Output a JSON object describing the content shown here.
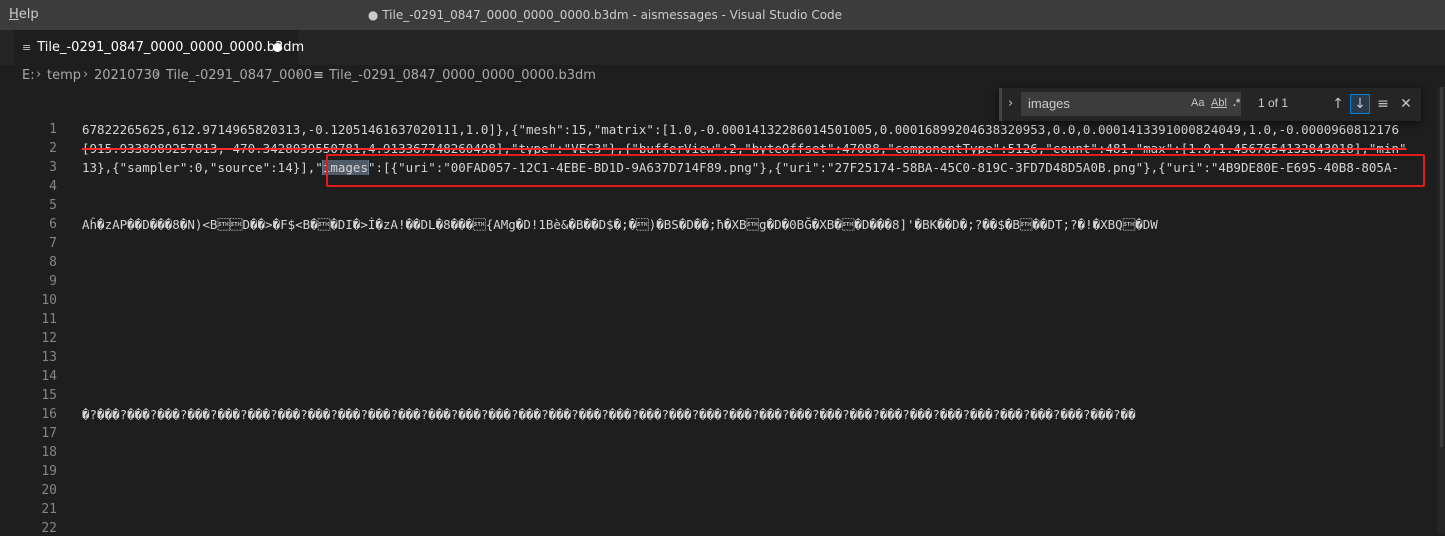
{
  "titlebar": {
    "menu_help_first": "H",
    "menu_help_rest": "elp",
    "window_title": "● Tile_-0291_0847_0000_0000_0000.b3dm - aismessages - Visual Studio Code"
  },
  "tab": {
    "label": "Tile_-0291_0847_0000_0000_0000.b3dm",
    "icon": "file-lines-icon"
  },
  "breadcrumb": {
    "items": [
      "E:",
      "temp",
      "20210730",
      "Tile_-0291_0847_0000",
      "Tile_-0291_0847_0000_0000_0000.b3dm"
    ]
  },
  "find": {
    "query": "images",
    "opt_case": "Aa",
    "opt_word": "Abl",
    "opt_regex": ".*",
    "count": "1 of 1",
    "colors": {
      "active_border": "#007fd4"
    }
  },
  "editor": {
    "line_numbers": [
      "1",
      "2",
      "3",
      "4",
      "5",
      "6",
      "7",
      "8",
      "9",
      "10",
      "11",
      "12",
      "13",
      "14",
      "15",
      "16",
      "17",
      "18",
      "19",
      "20",
      "21",
      "22"
    ],
    "line1": "67822265625,612.9714965820313,-0.12051461637020111,1.0]},{\"mesh\":15,\"matrix\":[1.0,-0.00014132286014501005,0.00016899204638320953,0.0,0.0001413391000824049,1.0,-0.0000960812176",
    "line2": "[915.9338989257813,-470.3428039550781,4.913367748260498],\"type\":\"VEC3\"},{\"bufferView\":2,\"byteOffset\":47088,\"componentType\":5126,\"count\":481,\"max\":[1.0,1.4567654132843018],\"min\"",
    "line3_pre": "13},{\"sampler\":0,\"source\":14}],\"",
    "line3_match": "images",
    "line3_post": "\":[{\"uri\":\"00FAD057-12C1-4EBE-BD1D-9A637D714F89.png\"},{\"uri\":\"27F25174-58BA-45C0-819C-3FD7D48D5A0B.png\"},{\"uri\":\"4B9DE80E-E695-40B8-805A-",
    "line6": "Aĥ�zAP��D���8�N)<B\u0002\u0002D��>�F$<B�\u0002�DI�>İ�zA!��DL�8���\u0002{AMg�D!1Bè&�B��D$�;�\u0002)�BS�D��;ħ�XB\u0002g�D�0BĞ�XB�\u0002�D���8]'�BK��D�;?��$�B\u0002��DT;?�!�XBQ\u0002�DW",
    "line16": "�?���?���?���?���?���?���?���?���?���?���?���?���?���?���?���?���?���?���?���?���?���?���?���?���?���?���?���?���?���?���?���?���?���?���?��"
  }
}
